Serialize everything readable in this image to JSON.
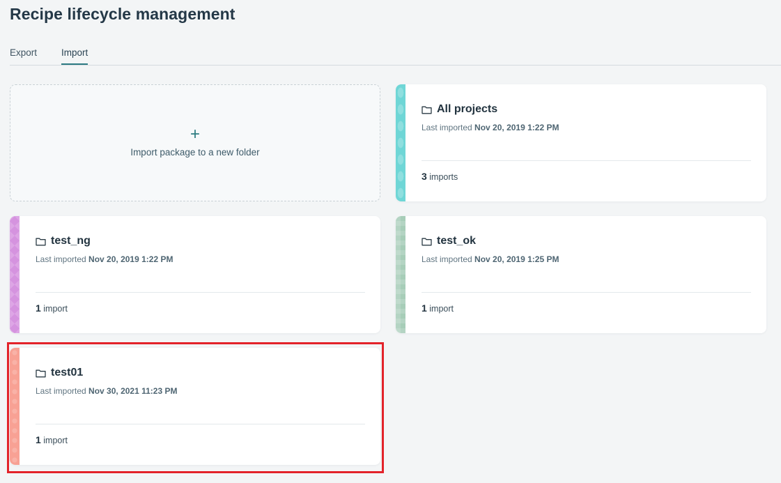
{
  "page": {
    "title": "Recipe lifecycle management"
  },
  "tabs": [
    {
      "label": "Export",
      "active": false
    },
    {
      "label": "Import",
      "active": true
    }
  ],
  "new_package": {
    "icon": "plus-icon",
    "plus": "+",
    "label": "Import package to a new folder"
  },
  "cards": [
    {
      "name": "All projects",
      "last_prefix": "Last imported",
      "date": "Nov 20, 2019 1:22 PM",
      "count": "3",
      "count_unit": "imports",
      "stripe_color": "#6fd6d6"
    },
    {
      "name": "test_ng",
      "last_prefix": "Last imported",
      "date": "Nov 20, 2019 1:22 PM",
      "count": "1",
      "count_unit": "import",
      "stripe_color": "#d593df"
    },
    {
      "name": "test_ok",
      "last_prefix": "Last imported",
      "date": "Nov 20, 2019 1:25 PM",
      "count": "1",
      "count_unit": "import",
      "stripe_color": "#a7cdb8"
    },
    {
      "name": "test01",
      "last_prefix": "Last imported",
      "date": "Nov 30, 2021 11:23 PM",
      "count": "1",
      "count_unit": "import",
      "stripe_color": "#f8a194",
      "highlighted": true
    }
  ],
  "colors": {
    "accent": "#2c7a82",
    "highlight": "#e3232a"
  }
}
